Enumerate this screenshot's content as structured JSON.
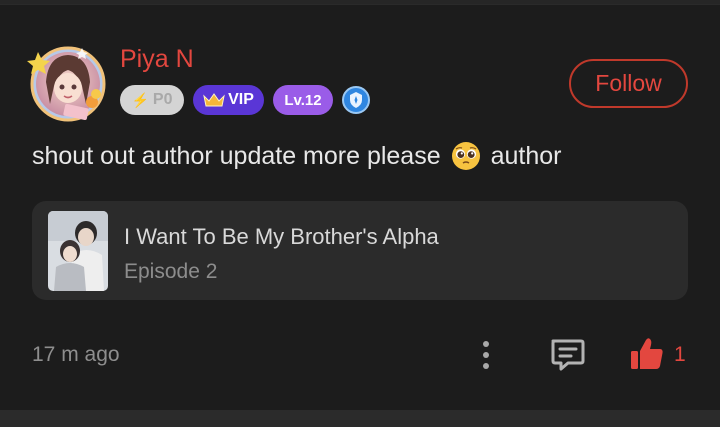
{
  "comment": {
    "user": {
      "name": "Piya N",
      "avatar_icon": "anime-girl-avatar",
      "badges": [
        {
          "label": "P0",
          "icon": "lightning-icon"
        },
        {
          "label": "VIP",
          "icon": "crown-icon"
        },
        {
          "label": "Lv.12"
        },
        {
          "icon": "shield-badge-icon"
        }
      ]
    },
    "follow_label": "Follow",
    "text_before": "shout out author update more please",
    "emoji": "pleading-face-emoji",
    "text_after": "author",
    "book": {
      "title": "I Want To Be My Brother's Alpha",
      "episode": "Episode 2"
    },
    "timestamp": "17 m ago",
    "like_count": "1"
  },
  "colors": {
    "background": "#1c1c1c",
    "accent_red": "#e3473f",
    "vip_purple": "#5a36d6",
    "level_purple": "#9a5ce8",
    "card_bg": "#2b2b2b"
  }
}
